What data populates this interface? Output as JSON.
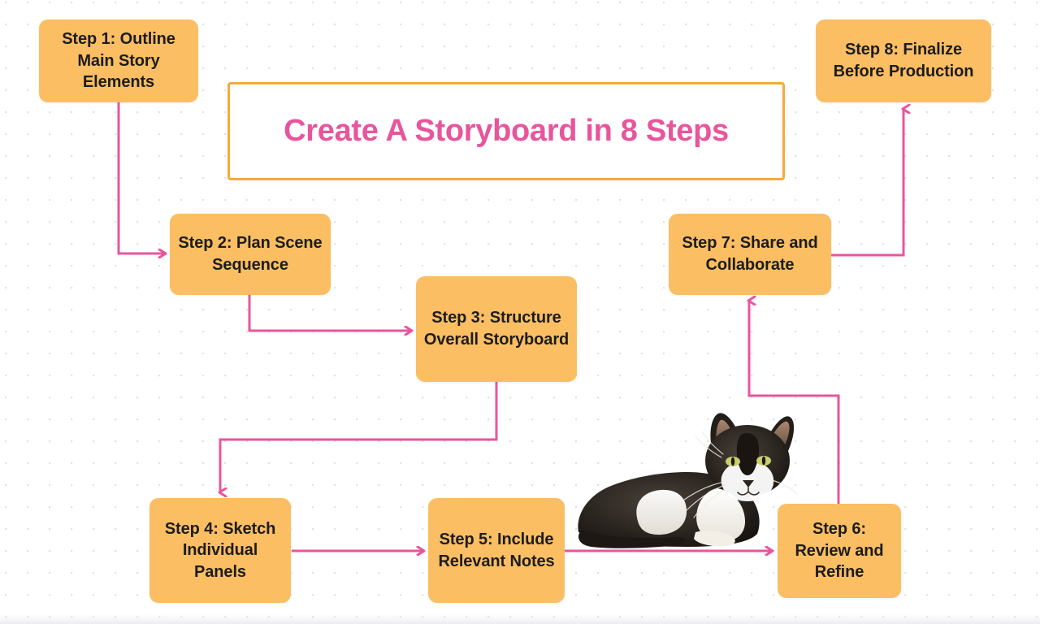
{
  "title": {
    "text": "Create A Storyboard in 8 Steps",
    "text_color": "#e8559c",
    "border_color": "#f5a93c"
  },
  "theme": {
    "node_fill": "#fbbe63",
    "node_text": "#1c1c1c",
    "connector": "#e8559c",
    "background": "#ffffff",
    "dot_color": "#e4e1e6"
  },
  "nodes": [
    {
      "id": "step1",
      "label": "Step 1: Outline Main Story Elements"
    },
    {
      "id": "step2",
      "label": "Step 2: Plan Scene Sequence"
    },
    {
      "id": "step3",
      "label": "Step 3: Structure Overall Storyboard"
    },
    {
      "id": "step4",
      "label": "Step 4: Sketch Individual Panels"
    },
    {
      "id": "step5",
      "label": "Step 5: Include Relevant Notes"
    },
    {
      "id": "step6",
      "label": "Step 6: Review and Refine"
    },
    {
      "id": "step7",
      "label": "Step 7: Share and Collaborate"
    },
    {
      "id": "step8",
      "label": "Step 8: Finalize Before Production"
    }
  ],
  "edges": [
    {
      "from": "step1",
      "to": "step2"
    },
    {
      "from": "step2",
      "to": "step3"
    },
    {
      "from": "step3",
      "to": "step4"
    },
    {
      "from": "step4",
      "to": "step5"
    },
    {
      "from": "step5",
      "to": "step6"
    },
    {
      "from": "step6",
      "to": "step7"
    },
    {
      "from": "step7",
      "to": "step8"
    }
  ],
  "image": {
    "alt": "tuxedo-cat-photo"
  }
}
